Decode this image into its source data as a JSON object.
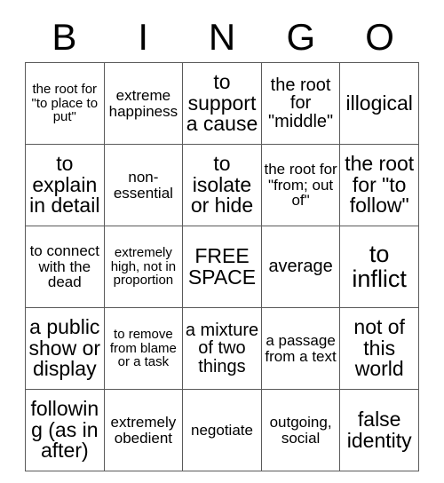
{
  "card": {
    "title_letters": [
      "B",
      "I",
      "N",
      "G",
      "O"
    ],
    "grid_size": "5x5",
    "free_space_label": "FREE SPACE",
    "colors": {
      "background": "#ffffff",
      "text": "#000000",
      "border": "#5a5a5a"
    },
    "rows": [
      [
        {
          "text": "the root for \"to place to put\"",
          "size": "fs-sm"
        },
        {
          "text": "extreme happiness",
          "size": "fs-md"
        },
        {
          "text": "to support a cause",
          "size": "fs-xl"
        },
        {
          "text": "the root for \"middle\"",
          "size": "fs-lg"
        },
        {
          "text": "illogical",
          "size": "fs-xl"
        }
      ],
      [
        {
          "text": "to explain in detail",
          "size": "fs-xl"
        },
        {
          "text": "non-essential",
          "size": "fs-md"
        },
        {
          "text": "to isolate or hide",
          "size": "fs-xl"
        },
        {
          "text": "the root for \"from; out of\"",
          "size": "fs-md"
        },
        {
          "text": "the root for \"to follow\"",
          "size": "fs-xl"
        }
      ],
      [
        {
          "text": "to connect with the dead",
          "size": "fs-md"
        },
        {
          "text": "extremely high, not in proportion",
          "size": "fs-sm"
        },
        {
          "text": "FREE SPACE",
          "size": "fs-free"
        },
        {
          "text": "average",
          "size": "fs-lg"
        },
        {
          "text": "to inflict",
          "size": "fs-xxl"
        }
      ],
      [
        {
          "text": "a public show or display",
          "size": "fs-xl"
        },
        {
          "text": "to remove from blame or a task",
          "size": "fs-sm"
        },
        {
          "text": "a mixture of two things",
          "size": "fs-lg"
        },
        {
          "text": "a passage from a text",
          "size": "fs-md"
        },
        {
          "text": "not of this world",
          "size": "fs-xl"
        }
      ],
      [
        {
          "text": "following (as in after)",
          "size": "fs-xl"
        },
        {
          "text": "extremely obedient",
          "size": "fs-md"
        },
        {
          "text": "negotiate",
          "size": "fs-md"
        },
        {
          "text": "outgoing, social",
          "size": "fs-md"
        },
        {
          "text": "false identity",
          "size": "fs-xl"
        }
      ]
    ]
  }
}
